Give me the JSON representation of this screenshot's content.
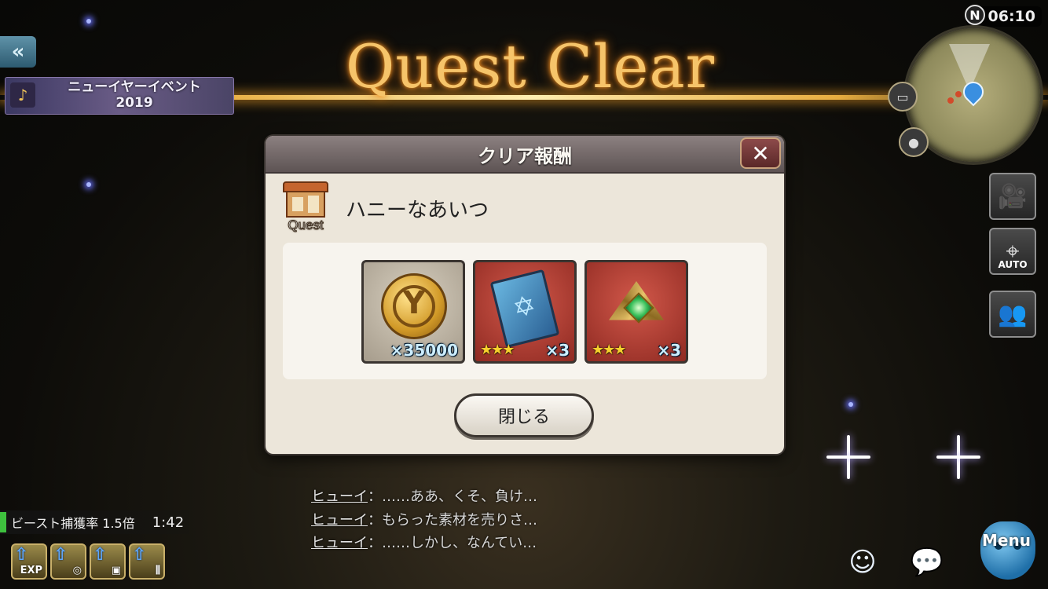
{
  "hud": {
    "back_icon": "double-chevron-left",
    "event_banner": {
      "title_line1": "ニューイヤーイベント",
      "title_line2": "2019"
    },
    "clock": {
      "compass": "N",
      "time": "06:10"
    },
    "side_buttons": {
      "camera_icon": "video-camera-icon",
      "auto_label": "AUTO",
      "party_icon": "group-icon"
    }
  },
  "banner": {
    "quest_clear": "Quest Clear"
  },
  "dialog": {
    "title": "クリア報酬",
    "close_symbol": "✕",
    "quest_icon_label": "Quest",
    "quest_name": "ハニーなあいつ",
    "rewards": [
      {
        "type": "gil-coin",
        "stars": "",
        "quantity": "×35000"
      },
      {
        "type": "blue-tome",
        "stars": "★★★",
        "quantity": "×3"
      },
      {
        "type": "green-gem-crest",
        "stars": "★★★",
        "quantity": "×3"
      }
    ],
    "close_button": "閉じる"
  },
  "chat": [
    {
      "speaker": "ヒューイ",
      "sep": "：",
      "text": "……ああ、くそ、負け…"
    },
    {
      "speaker": "ヒューイ",
      "sep": "：",
      "text": "もらった素材を売りさ…"
    },
    {
      "speaker": "ヒューイ",
      "sep": "：",
      "text": "……しかし、なんてい…"
    }
  ],
  "status": {
    "capture_label": "ビースト捕獲率 1.5倍",
    "capture_time": "1:42"
  },
  "boost_buttons": [
    {
      "icon": "exp-up-icon",
      "label": "EXP"
    },
    {
      "icon": "gil-up-icon",
      "label": ""
    },
    {
      "icon": "item-up-icon",
      "label": ""
    },
    {
      "icon": "drop-up-icon",
      "label": ""
    }
  ],
  "bottom_right": {
    "emote_icon": "smiley-icon",
    "chat_icon": "chat-bubble-icon",
    "menu_label": "Menu"
  },
  "colors": {
    "quest_clear_gold": "#f6c46a",
    "dialog_bg": "#ece6da",
    "dialog_header": "#6e6464",
    "close_red": "#7a3a3a"
  }
}
